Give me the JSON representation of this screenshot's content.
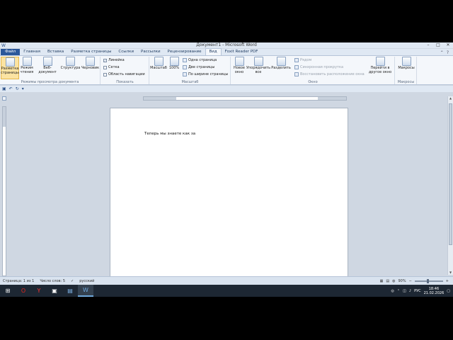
{
  "window": {
    "title": "Документ1 - Microsoft Word"
  },
  "tabs": [
    {
      "label": "Файл",
      "kind": "file"
    },
    {
      "label": "Главная"
    },
    {
      "label": "Вставка"
    },
    {
      "label": "Разметка страницы"
    },
    {
      "label": "Ссылки"
    },
    {
      "label": "Рассылки"
    },
    {
      "label": "Рецензирование"
    },
    {
      "label": "Вид",
      "active": true
    },
    {
      "label": "Foxit Reader PDF"
    }
  ],
  "ribbon": {
    "views_group": {
      "label": "Режимы просмотра документа",
      "print_layout": "Разметка страницы",
      "full_reading": "Режим чтения",
      "web_layout": "Веб-документ",
      "outline": "Структура",
      "draft": "Черновик"
    },
    "show_group": {
      "label": "Показать",
      "ruler": "Линейка",
      "grid": "Сетка",
      "nav_pane": "Область навигации",
      "ruler_checked": true
    },
    "zoom_group": {
      "label": "Масштаб",
      "zoom": "Масштаб",
      "hundred": "100%",
      "one_page": "Одна страница",
      "two_pages": "Две страницы",
      "page_width": "По ширине страницы"
    },
    "window_group": {
      "label": "Окно",
      "new_window": "Новое окно",
      "arrange_all": "Упорядочить все",
      "split": "Разделить",
      "side_by_side": "Рядом",
      "sync_scroll": "Синхронная прокрутка",
      "reset_position": "Восстановить расположение окна",
      "switch_windows": "Перейти в другое окно"
    },
    "macros_group": {
      "label": "Макросы",
      "macros": "Макросы"
    }
  },
  "document": {
    "text": "Теперь мы знаете как за"
  },
  "statusbar": {
    "page": "Страница: 1 из 1",
    "words": "Число слов: 5",
    "language": "русский",
    "zoom": "90%"
  },
  "taskbar": {
    "lang": "РУС",
    "time": "18:46",
    "date": "21.02.2026"
  }
}
